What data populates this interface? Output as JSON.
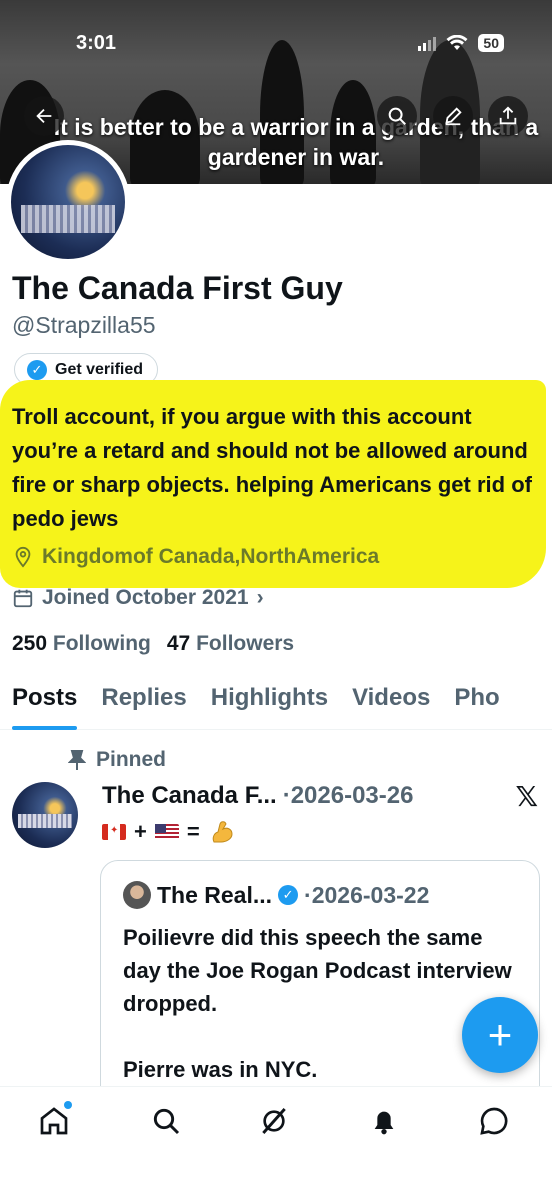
{
  "status_bar": {
    "time": "3:01",
    "battery": "50"
  },
  "banner": {
    "quote": "It is better to be a warrior in a garden, than a gardener in war."
  },
  "profile": {
    "name": "The Canada First Guy",
    "handle": "@Strapzilla55",
    "verify_label": "Get verified",
    "bio": "Troll account, if you argue with this account you’re a retard and should not be allowed around fire or sharp objects. helping Americans get rid of pedo jews",
    "location": "Kingdomof Canada,NorthAmerica",
    "joined": "Joined October 2021",
    "following_count": "250",
    "following_label": "Following",
    "followers_count": "47",
    "followers_label": "Followers"
  },
  "tabs": [
    {
      "label": "Posts"
    },
    {
      "label": "Replies"
    },
    {
      "label": "Highlights"
    },
    {
      "label": "Videos"
    },
    {
      "label": "Pho"
    }
  ],
  "pinned_post": {
    "pinned_label": "Pinned",
    "author": "The Canada F...",
    "date": "·2026-03-26",
    "body_plus": "+",
    "body_equals": "=",
    "quoted": {
      "author": "The Real...",
      "date": "·2026-03-22",
      "text_line1": "Poilievre did this speech the same day the Joe Rogan Podcast interview dropped.",
      "text_line2": "Pierre was in NYC."
    }
  },
  "colors": {
    "accent": "#1d9bf0",
    "highlight": "#f6f31a",
    "text": "#0f1419",
    "muted": "#536471"
  },
  "icons": [
    "back-icon",
    "search-icon",
    "edit-icon",
    "share-icon",
    "pin-icon",
    "x-logo-icon",
    "home-icon",
    "explore-icon",
    "grok-icon",
    "notifications-icon",
    "messages-icon",
    "compose-plus-icon"
  ]
}
